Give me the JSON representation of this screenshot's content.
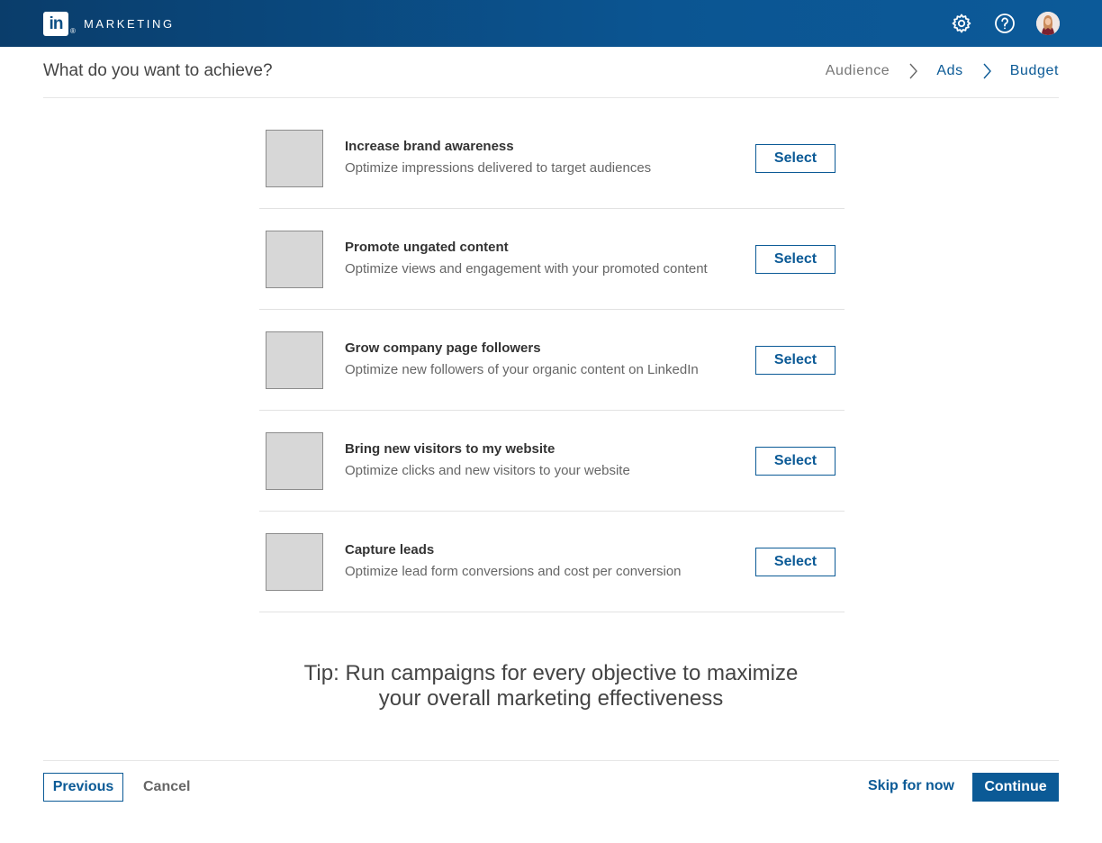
{
  "header": {
    "logo_text": "in",
    "logo_mark": "®",
    "brand": "MARKETING",
    "icons": [
      "gear-icon",
      "help-icon",
      "avatar"
    ],
    "bar_color": "#0b5592"
  },
  "page": {
    "question": "What do you want to achieve?",
    "steps": [
      {
        "label": "Audience",
        "state": "inactive"
      },
      {
        "label": "Ads",
        "state": "active"
      },
      {
        "label": "Budget",
        "state": "active"
      }
    ]
  },
  "objectives": [
    {
      "title": "Increase brand awareness",
      "description": "Optimize impressions delivered to target audiences",
      "button": "Select"
    },
    {
      "title": "Promote ungated content",
      "description": "Optimize views and engagement with your promoted content",
      "button": "Select"
    },
    {
      "title": "Grow company page followers",
      "description": "Optimize new followers of your organic content on LinkedIn",
      "button": "Select"
    },
    {
      "title": "Bring new visitors to my website",
      "description": "Optimize clicks and new visitors to your website",
      "button": "Select"
    },
    {
      "title": "Capture leads",
      "description": "Optimize lead form conversions and cost per conversion",
      "button": "Select"
    }
  ],
  "tip": {
    "line1": "Tip: Run campaigns for every objective to maximize",
    "line2": "your overall marketing effectiveness"
  },
  "footer": {
    "previous": "Previous",
    "cancel": "Cancel",
    "skip": "Skip for now",
    "continue": "Continue"
  },
  "colors": {
    "accent": "#0b5a96",
    "thumb": "#d7d7d7"
  }
}
